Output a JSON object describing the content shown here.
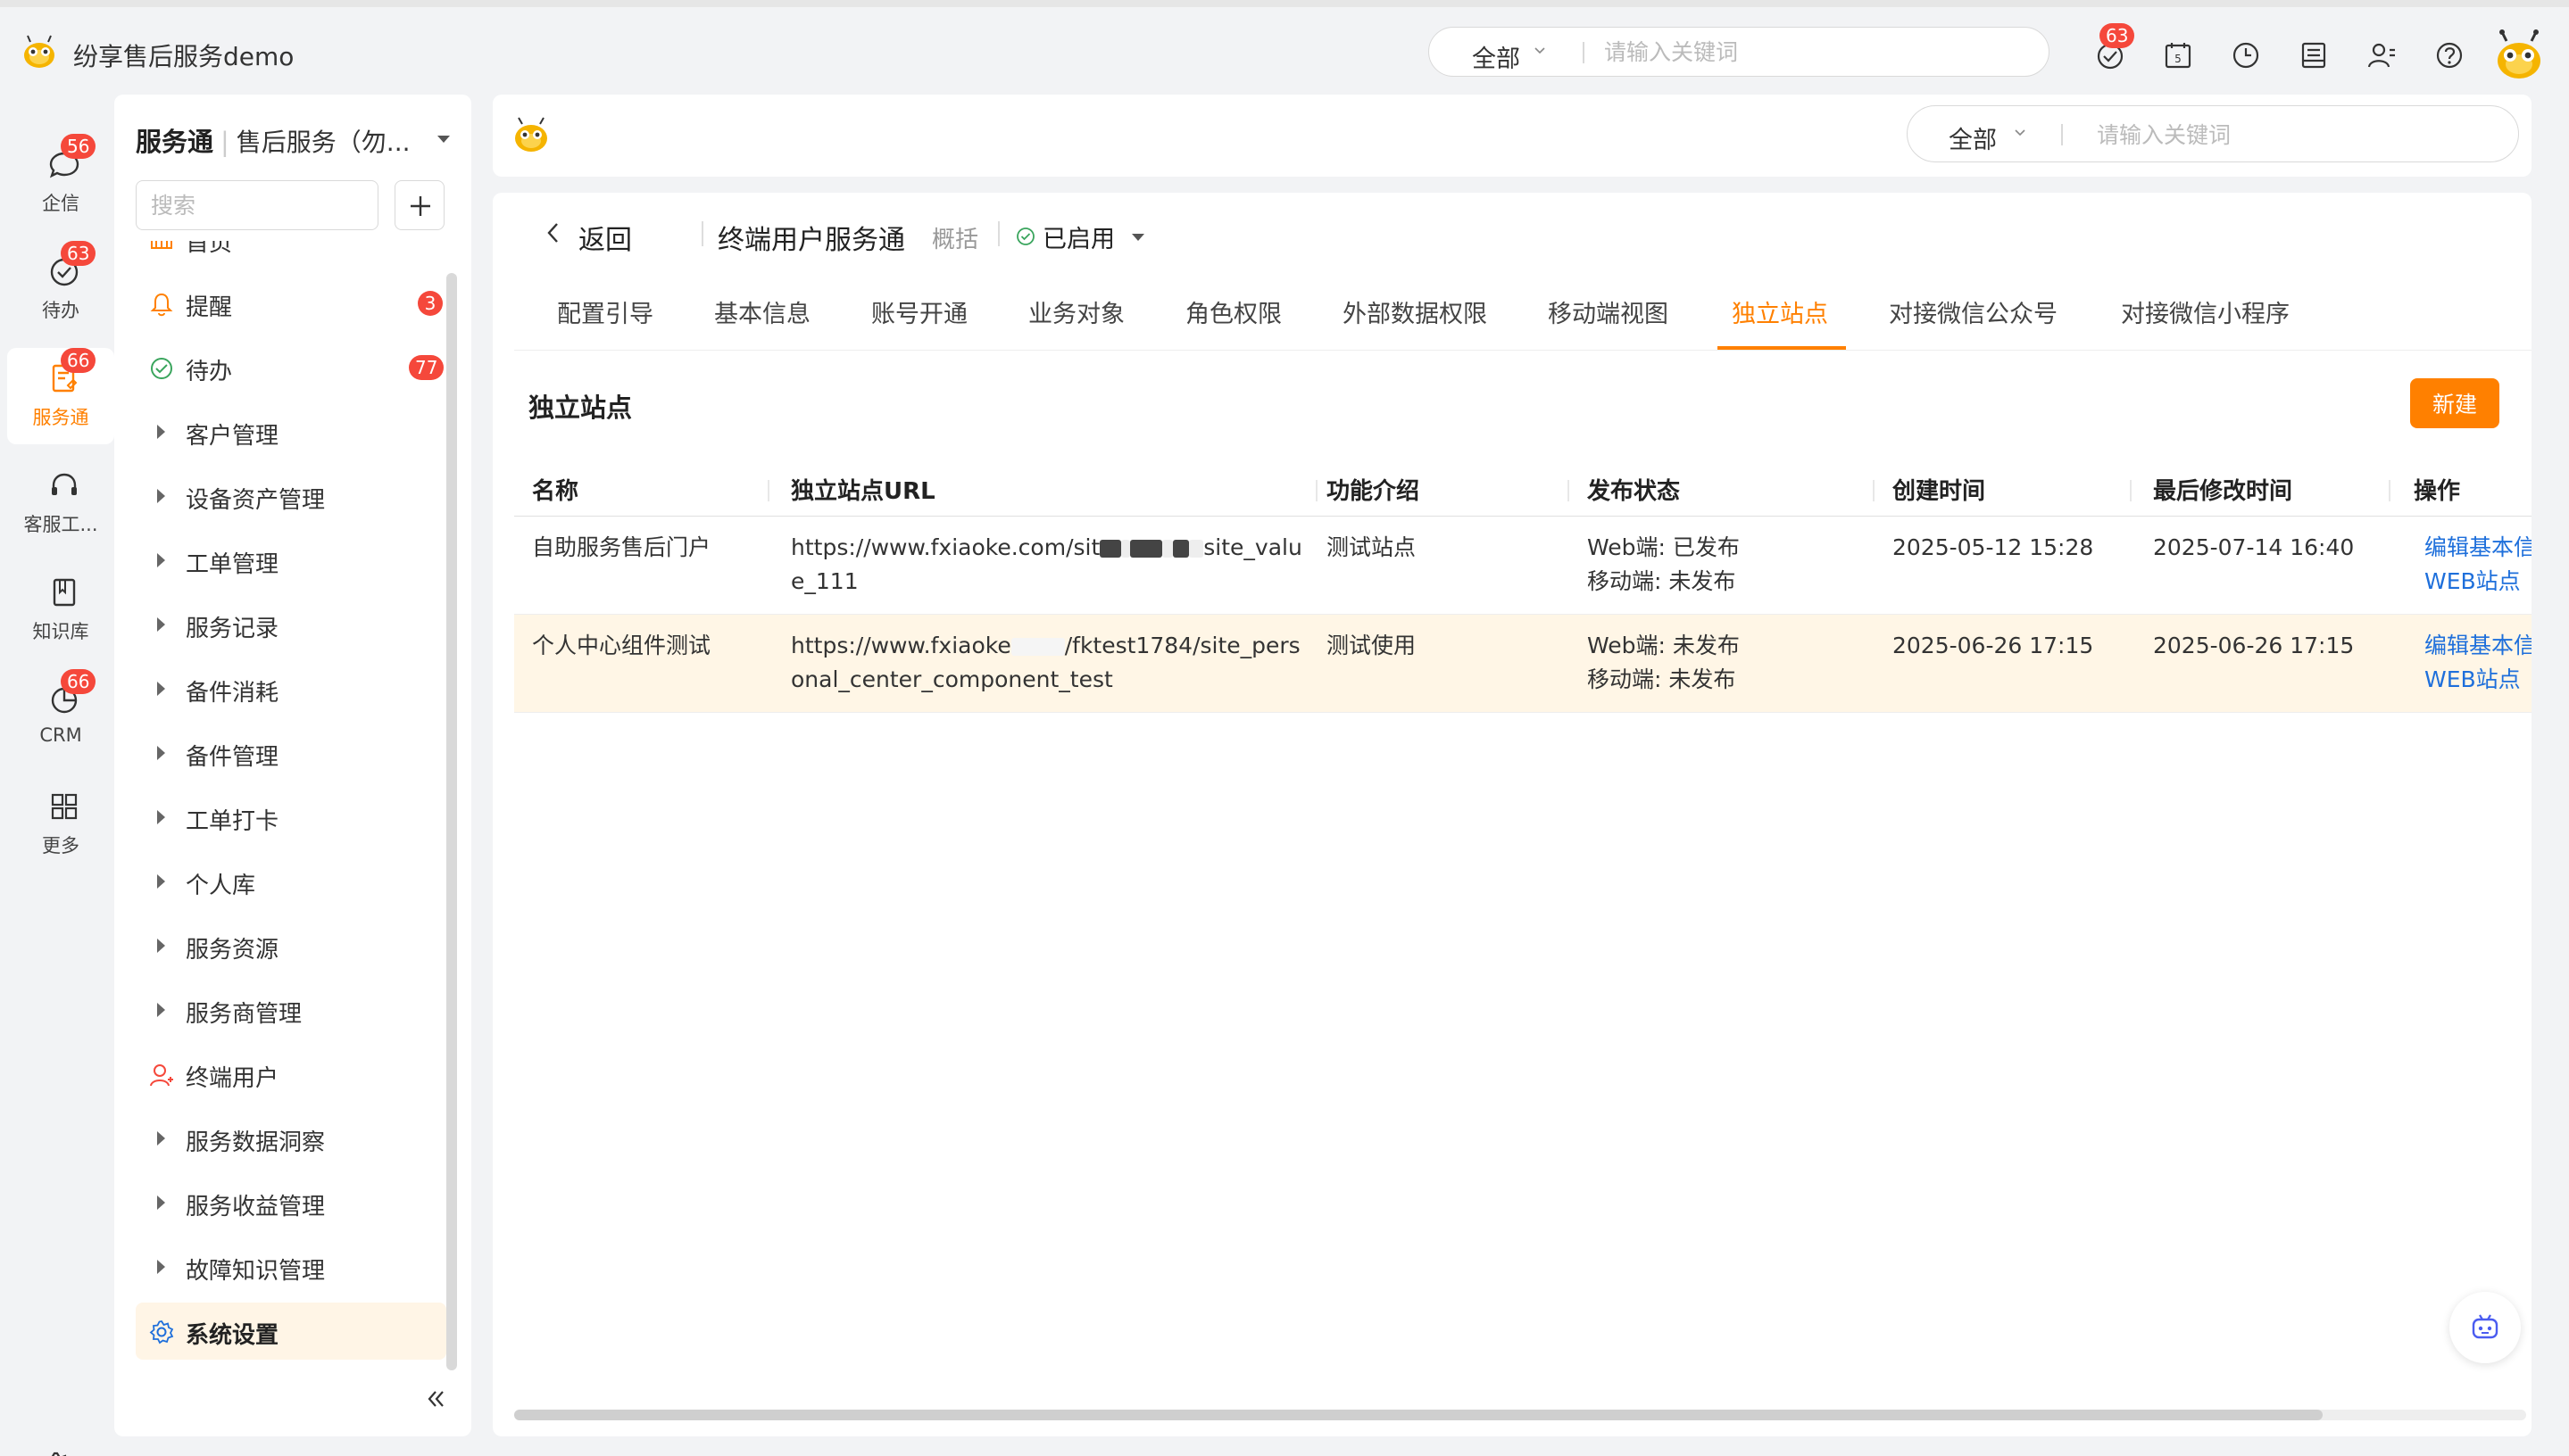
{
  "app": {
    "title": "纷享售后服务demo"
  },
  "global_search": {
    "scope": "全部",
    "placeholder": "请输入关键词"
  },
  "top_icons": [
    {
      "name": "todo-check-icon",
      "badge": "63"
    },
    {
      "name": "calendar-icon"
    },
    {
      "name": "clock-icon"
    },
    {
      "name": "notebook-icon"
    },
    {
      "name": "contacts-icon"
    },
    {
      "name": "help-icon"
    }
  ],
  "rail": {
    "items": [
      {
        "label": "企信",
        "badge": "56",
        "icon": "chat-icon"
      },
      {
        "label": "待办",
        "badge": "63",
        "icon": "todo-icon"
      },
      {
        "label": "服务通",
        "badge": "66",
        "icon": "service-icon",
        "active": true
      },
      {
        "label": "客服工...",
        "icon": "headset-icon"
      },
      {
        "label": "知识库",
        "icon": "book-icon"
      },
      {
        "label": "CRM",
        "badge": "66",
        "icon": "crm-icon"
      },
      {
        "label": "更多",
        "icon": "grid-icon"
      }
    ]
  },
  "menu": {
    "app_name": "服务通",
    "sub_name": "售后服务（勿...",
    "search_placeholder": "搜索",
    "items": [
      {
        "label": "首页",
        "icon": "home-icon"
      },
      {
        "label": "提醒",
        "icon": "bell-icon",
        "badge": "3"
      },
      {
        "label": "待办",
        "icon": "check-circle-icon",
        "badge": "77"
      },
      {
        "label": "客户管理"
      },
      {
        "label": "设备资产管理"
      },
      {
        "label": "工单管理"
      },
      {
        "label": "服务记录"
      },
      {
        "label": "备件消耗"
      },
      {
        "label": "备件管理"
      },
      {
        "label": "工单打卡"
      },
      {
        "label": "个人库"
      },
      {
        "label": "服务资源"
      },
      {
        "label": "服务商管理"
      },
      {
        "label": "终端用户",
        "icon": "user-icon"
      },
      {
        "label": "服务数据洞察"
      },
      {
        "label": "服务收益管理"
      },
      {
        "label": "故障知识管理"
      },
      {
        "label": "系统设置",
        "icon": "settings-icon",
        "active": true
      }
    ]
  },
  "main_search": {
    "scope": "全部",
    "placeholder": "请输入关键词"
  },
  "breadcrumb": {
    "back": "返回",
    "title": "终端用户服务通",
    "overview": "概括",
    "status": "已启用"
  },
  "tabs": [
    "配置引导",
    "基本信息",
    "账号开通",
    "业务对象",
    "角色权限",
    "外部数据权限",
    "移动端视图",
    "独立站点",
    "对接微信公众号",
    "对接微信小程序"
  ],
  "active_tab": "独立站点",
  "section": {
    "title": "独立站点",
    "new_button": "新建"
  },
  "table": {
    "columns": [
      "名称",
      "独立站点URL",
      "功能介绍",
      "发布状态",
      "创建时间",
      "最后修改时间",
      "操作"
    ],
    "rows": [
      {
        "name": "自助服务售后门户",
        "url_a": "https://www.fxiaoke.com/sit",
        "url_b": "site_value_111",
        "intro": "测试站点",
        "web": "Web端: 已发布",
        "mobile": "移动端: 未发布",
        "created": "2025-05-12 15:28",
        "modified": "2025-07-14 16:40",
        "action1": "编辑基本信息",
        "action2": "WEB站点"
      },
      {
        "name": "个人中心组件测试",
        "url_a": "https://www.fxiaoke",
        "url_b": "/fktest1784/site_personal_center_component_test",
        "intro": "测试使用",
        "web": "Web端: 未发布",
        "mobile": "移动端: 未发布",
        "created": "2025-06-26 17:15",
        "modified": "2025-06-26 17:15",
        "action1": "编辑基本信息",
        "action2": "WEB站点"
      }
    ]
  },
  "colors": {
    "accent": "#ff8000",
    "badge": "#f5483b",
    "link": "#1e6fdb",
    "row_highlight": "#fff6e6"
  }
}
